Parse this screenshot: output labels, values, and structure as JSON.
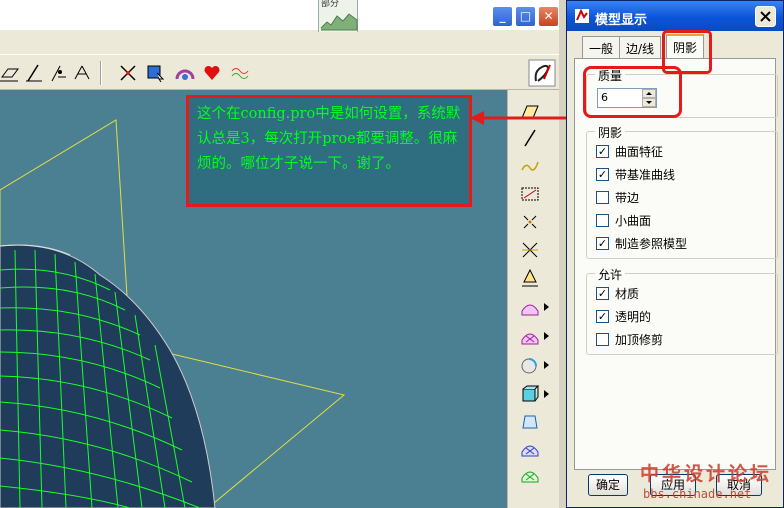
{
  "app": {
    "thumbnail_label": "部分",
    "window_buttons": {
      "minimize": "_",
      "maximize": "□",
      "close": "✕"
    },
    "toolbar_icons": [
      "datum-plane-icon",
      "datum-axis-icon",
      "datum-point-icon",
      "coord-sys-icon",
      "spin-center-icon",
      "select-icon",
      "shaded-box-icon",
      "appearance-icon",
      "heart-icon",
      "analysis-icon",
      "sketch-tool-icon"
    ],
    "feature_toolbar_icons": [
      "datum-plane-tool-icon",
      "datum-axis-tool-icon",
      "sketched-curve-icon",
      "datum-curve-icon",
      "datum-point-tool-icon",
      "offset-point-icon",
      "field-point-icon",
      "surface-tool-icon",
      "merge-tool-icon",
      "extend-tool-icon",
      "solid-tool-icon",
      "style-surface-icon",
      "boundary-blend-icon",
      "variable-section-icon"
    ]
  },
  "note": {
    "text": "这个在config.pro中是如何设置，系统默认总是3，每次打开proe都要调整。很麻烦的。哪位才子说一下。谢了。"
  },
  "dialog": {
    "title": "模型显示",
    "tabs": [
      "一般",
      "边/线",
      "阴影"
    ],
    "active_tab": "阴影",
    "quality": {
      "label": "质量",
      "value": "6"
    },
    "shading": {
      "label": "阴影",
      "options": [
        {
          "label": "曲面特征",
          "checked": true
        },
        {
          "label": "带基准曲线",
          "checked": true
        },
        {
          "label": "带边",
          "checked": false
        },
        {
          "label": "小曲面",
          "checked": false
        },
        {
          "label": "制造参照模型",
          "checked": true
        }
      ]
    },
    "allow": {
      "label": "允许",
      "options": [
        {
          "label": "材质",
          "checked": true
        },
        {
          "label": "透明的",
          "checked": true
        },
        {
          "label": "加顶修剪",
          "checked": false
        }
      ]
    },
    "buttons": {
      "ok": "确定",
      "apply": "应用",
      "cancel": "取消"
    }
  },
  "watermark": {
    "line1": "中华设计论坛",
    "line2": "bbs.chinade.net"
  },
  "colors": {
    "viewport": "#4b7f92",
    "highlight": "#e41b1b",
    "note_text": "#00ff1e"
  }
}
